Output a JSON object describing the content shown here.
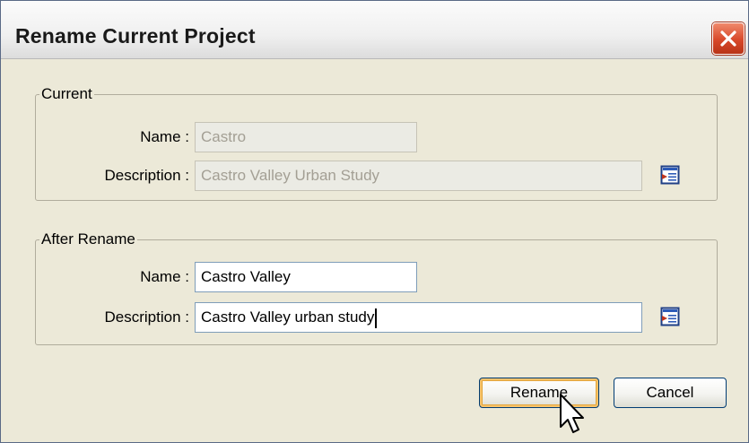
{
  "dialog": {
    "title": "Rename Current Project"
  },
  "current": {
    "legend": "Current",
    "name_label": "Name :",
    "name_value": "Castro",
    "description_label": "Description :",
    "description_value": "Castro Valley Urban Study"
  },
  "after_rename": {
    "legend": "After Rename",
    "name_label": "Name :",
    "name_value": "Castro Valley",
    "description_label": "Description :",
    "description_value": "Castro Valley urban study"
  },
  "buttons": {
    "rename": "Rename",
    "cancel": "Cancel"
  },
  "icons": {
    "close": "close-icon",
    "edit_description": "edit-description-icon",
    "cursor": "mouse-pointer-icon"
  },
  "colors": {
    "close_button": "#d8482a",
    "default_button_focus": "#e4a53a",
    "field_border": "#7f9db9"
  }
}
